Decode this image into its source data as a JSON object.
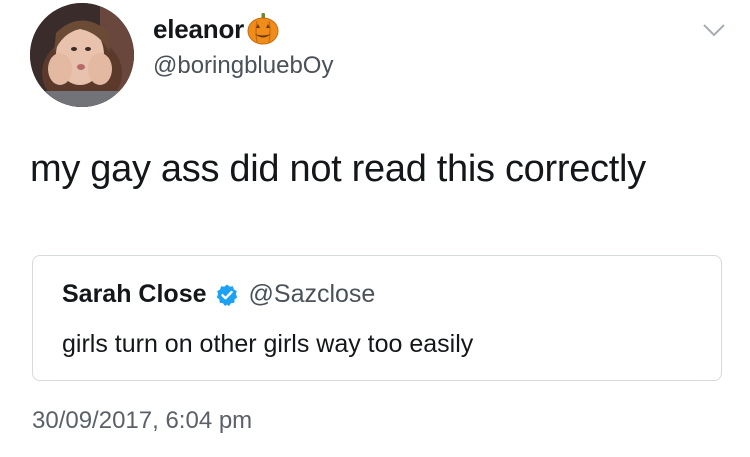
{
  "author": {
    "display_name": "eleanor",
    "name_emoji": "pumpkin-icon",
    "handle": "@boringbluebOy"
  },
  "tweet": {
    "text": "my gay ass did not read this correctly",
    "timestamp": "30/09/2017, 6:04 pm"
  },
  "quoted_tweet": {
    "display_name": "Sarah Close",
    "verified": true,
    "handle": "@Sazclose",
    "text": "girls turn on other girls way too easily"
  },
  "icons": {
    "menu": "chevron-down-icon",
    "verified": "verified-badge-icon"
  },
  "colors": {
    "verified_blue": "#1da1f2",
    "pumpkin_orange": "#f08c1a",
    "secondary_text": "#4a5158",
    "quote_border": "#d6dadf"
  }
}
